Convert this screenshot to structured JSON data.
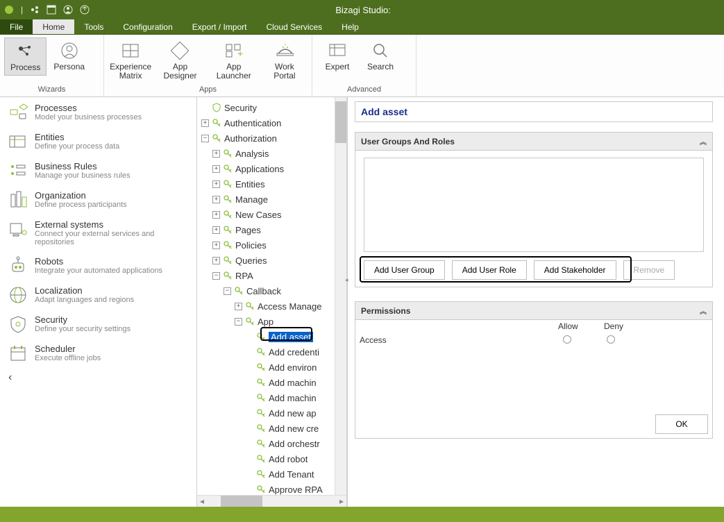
{
  "titlebar": {
    "app": "Bizagi Studio:"
  },
  "menu": {
    "file": "File",
    "home": "Home",
    "tools": "Tools",
    "configuration": "Configuration",
    "export_import": "Export / Import",
    "cloud_services": "Cloud Services",
    "help": "Help"
  },
  "ribbon": {
    "wizards": {
      "label": "Wizards",
      "process": "Process",
      "persona": "Persona"
    },
    "apps": {
      "label": "Apps",
      "experience_matrix": "Experience\nMatrix",
      "app_designer": "App Designer",
      "app_launcher": "App Launcher",
      "work_portal": "Work Portal"
    },
    "advanced": {
      "label": "Advanced",
      "expert": "Expert",
      "search": "Search"
    }
  },
  "sidebar": [
    {
      "title": "Processes",
      "sub": "Model your business processes"
    },
    {
      "title": "Entities",
      "sub": "Define your process data"
    },
    {
      "title": "Business Rules",
      "sub": "Manage your business rules"
    },
    {
      "title": "Organization",
      "sub": "Define process participants"
    },
    {
      "title": "External systems",
      "sub": "Connect your external services and repositories"
    },
    {
      "title": "Robots",
      "sub": "Integrate your automated applications"
    },
    {
      "title": "Localization",
      "sub": "Adapt languages and regions"
    },
    {
      "title": "Security",
      "sub": "Define your security settings"
    },
    {
      "title": "Scheduler",
      "sub": "Execute offline jobs"
    }
  ],
  "tree": {
    "root": "Security",
    "authentication": "Authentication",
    "authorization": "Authorization",
    "nodes": [
      "Analysis",
      "Applications",
      "Entities",
      "Manage",
      "New Cases",
      "Pages",
      "Policies",
      "Queries",
      "RPA"
    ],
    "rpa_children": {
      "callback": "Callback",
      "access_manage": "Access Manage",
      "app": "App",
      "app_children": [
        "Add asset",
        "Add credenti",
        "Add environ",
        "Add machin",
        "Add machin",
        "Add new ap",
        "Add new cre",
        "Add orchestr",
        "Add robot",
        "Add Tenant",
        "Approve RPA"
      ]
    }
  },
  "content": {
    "heading": "Add asset",
    "groups_panel": {
      "title": "User Groups And Roles",
      "add_user_group": "Add User Group",
      "add_user_role": "Add User Role",
      "add_stakeholder": "Add Stakeholder",
      "remove": "Remove"
    },
    "permissions_panel": {
      "title": "Permissions",
      "allow": "Allow",
      "deny": "Deny",
      "access": "Access",
      "ok": "OK"
    }
  }
}
